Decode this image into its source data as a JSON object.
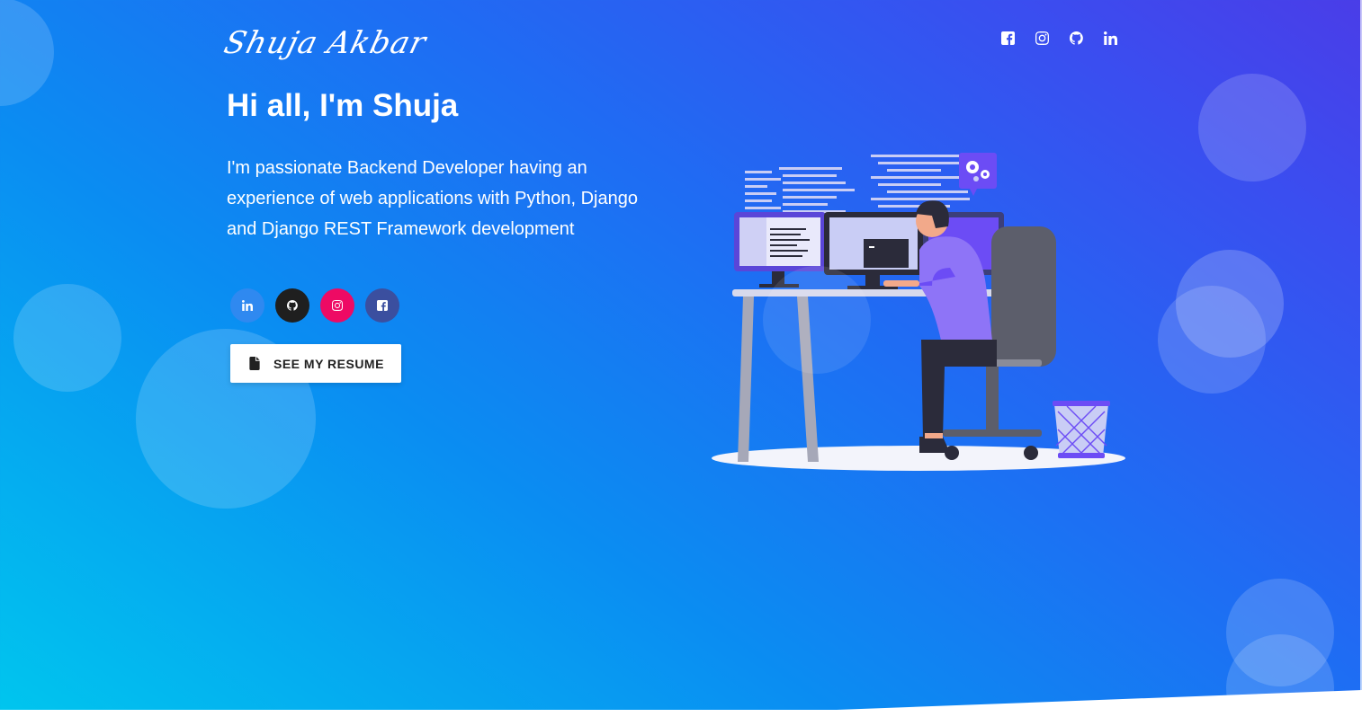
{
  "header": {
    "logo_text": "Shuja Akbar",
    "social_icons": [
      {
        "name": "facebook",
        "icon": "facebook-square-icon"
      },
      {
        "name": "instagram",
        "icon": "instagram-icon"
      },
      {
        "name": "github",
        "icon": "github-icon"
      },
      {
        "name": "linkedin",
        "icon": "linkedin-icon"
      }
    ]
  },
  "hero": {
    "title": "Hi all, I'm Shuja",
    "description": "I'm passionate Backend Developer having an experience of web applications with Python, Django and Django REST Framework development",
    "social_buttons": [
      {
        "name": "linkedin",
        "icon": "linkedin-icon",
        "color": "#2f89f0"
      },
      {
        "name": "github",
        "icon": "github-icon",
        "color": "#1f1f1f"
      },
      {
        "name": "instagram",
        "icon": "instagram-icon",
        "color": "#ee0a64"
      },
      {
        "name": "facebook",
        "icon": "facebook-square-icon",
        "color": "#3b4f9f"
      }
    ],
    "resume_button": {
      "label": "SEE MY RESUME",
      "icon": "file-icon"
    }
  },
  "theme": {
    "gradient_start": "#00c6ee",
    "gradient_end": "#4a3de8",
    "accent_purple": "#6c4cf5"
  }
}
